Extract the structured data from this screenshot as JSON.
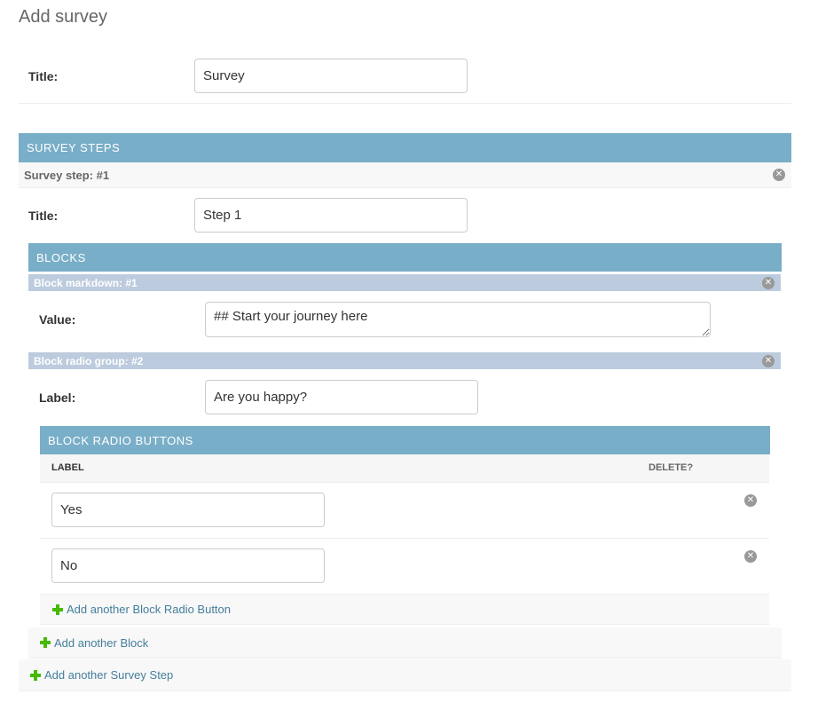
{
  "page": {
    "title": "Add survey"
  },
  "survey": {
    "title_label": "Title:",
    "title_value": "Survey"
  },
  "survey_steps": {
    "header": "SURVEY STEPS",
    "step1": {
      "bar_label": "Survey step: #1",
      "title_label": "Title:",
      "title_value": "Step 1"
    },
    "add_label": "Add another Survey Step"
  },
  "blocks": {
    "header": "BLOCKS",
    "markdown": {
      "bar_label": "Block markdown: #1",
      "value_label": "Value:",
      "value": "## Start your journey here"
    },
    "radio_group": {
      "bar_label": "Block radio group: #2",
      "label_label": "Label:",
      "label_value": "Are you happy?"
    },
    "add_label": "Add another Block"
  },
  "radio_buttons": {
    "header": "BLOCK RADIO BUTTONS",
    "columns": {
      "label": "LABEL",
      "delete": "DELETE?"
    },
    "rows": [
      {
        "value": "Yes"
      },
      {
        "value": "No"
      }
    ],
    "add_label": "Add another Block Radio Button"
  },
  "icons": {
    "delete": "close-circle-icon",
    "add": "plus-icon"
  },
  "colors": {
    "module_header": "#79aec8",
    "inline_bar": "#bccbdd",
    "link": "#447e9b",
    "add_plus": "#44bb00"
  }
}
